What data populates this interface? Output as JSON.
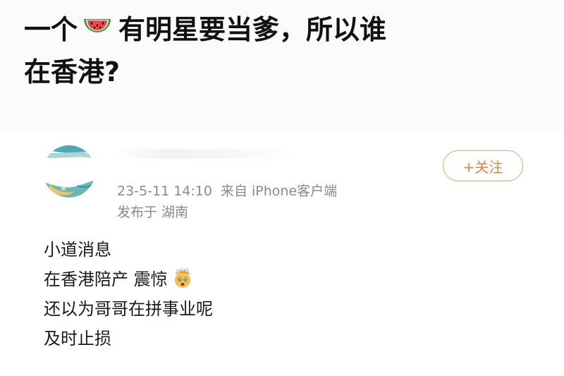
{
  "headline": {
    "part1": "一个",
    "watermelon_icon": "watermelon-icon",
    "part2": "有明星要当爹，所以谁",
    "part3": "在香港?"
  },
  "post": {
    "timestamp": "23-5-11 14:10",
    "source": "来自 iPhone客户端",
    "location": "发布于 湖南",
    "follow_label": "+关注",
    "lines": [
      "小道消息",
      "在香港陪产 震惊",
      "还以为哥哥在拼事业呢",
      "及时止损"
    ],
    "shock_emoji_icon": "exploding-head-icon"
  },
  "colors": {
    "accent": "#e0883f",
    "meta_text": "#8a8a8a",
    "body_text": "#1a1a1a"
  }
}
